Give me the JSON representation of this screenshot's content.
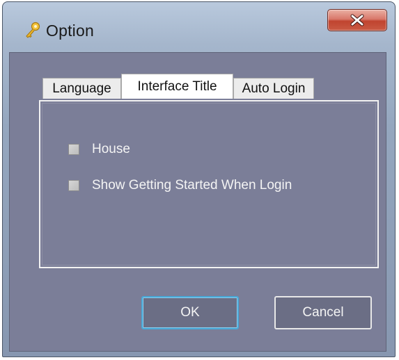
{
  "window": {
    "title": "Option",
    "icon": "key-icon",
    "close_icon": "close-icon"
  },
  "tabs": [
    {
      "label": "Language",
      "active": false
    },
    {
      "label": "Interface Title",
      "active": true
    },
    {
      "label": "Auto Login",
      "active": false
    }
  ],
  "panel": {
    "checkboxes": [
      {
        "label": "House",
        "checked": false
      },
      {
        "label": "Show Getting Started When Login",
        "checked": false
      }
    ]
  },
  "buttons": {
    "ok_label": "OK",
    "cancel_label": "Cancel"
  },
  "colors": {
    "client_background": "#7b7e98",
    "default_button_border": "#49a7d6",
    "close_button": "#c0442f"
  }
}
